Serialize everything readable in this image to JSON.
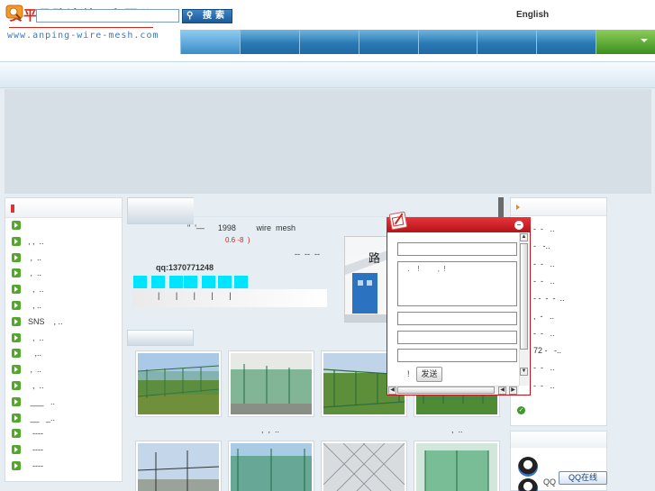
{
  "header": {
    "logo_cn": "安平县路达丝网有限公司",
    "logo_url": "www.anping-wire-mesh.com",
    "lang_link": "English",
    "nav_colors": {
      "blue": "#2a7ab4",
      "green": "#3b8f1d"
    }
  },
  "search": {
    "input_value": "",
    "button_label": "搜索"
  },
  "left": {
    "categories": [
      {
        "label": ""
      },
      {
        "label": ", ,  .."
      },
      {
        "label": " ,  .."
      },
      {
        "label": " ,  .."
      },
      {
        "label": "  ,  .."
      },
      {
        "label": "  , .."
      },
      {
        "label": "SNS    , .."
      },
      {
        "label": "  ,  .."
      },
      {
        "label": "   ,.."
      },
      {
        "label": " ,  .."
      },
      {
        "label": "  ,  .."
      },
      {
        "label": " ___   .."
      },
      {
        "label": " __   _.."
      },
      {
        "label": "  ----"
      },
      {
        "label": "  ----"
      },
      {
        "label": "  ----"
      }
    ]
  },
  "about": {
    "line1": "\"  '—      1998         wire  mesh",
    "line2": "0.6 -8  )",
    "line3": "--  --  --",
    "qq": "qq:1370771248",
    "links": "|       |       |       |       |"
  },
  "products": {
    "captions": [
      ",  ,  ..",
      "  ,  .."
    ]
  },
  "right": {
    "news": [
      "-  -   ..",
      "-   -..",
      "-  -   ..",
      "-  -   ..",
      "- -  -  -  ..",
      ",  -   ..",
      "-  -   ..",
      "72 -   -..",
      "-  -   ..",
      "-  -   .."
    ],
    "qq_label": "QQ",
    "qq_online": "QQ在线"
  },
  "message_popup": {
    "textarea_text": "  .    !         ,  !",
    "send_hint": "!",
    "send_button": "发送"
  }
}
